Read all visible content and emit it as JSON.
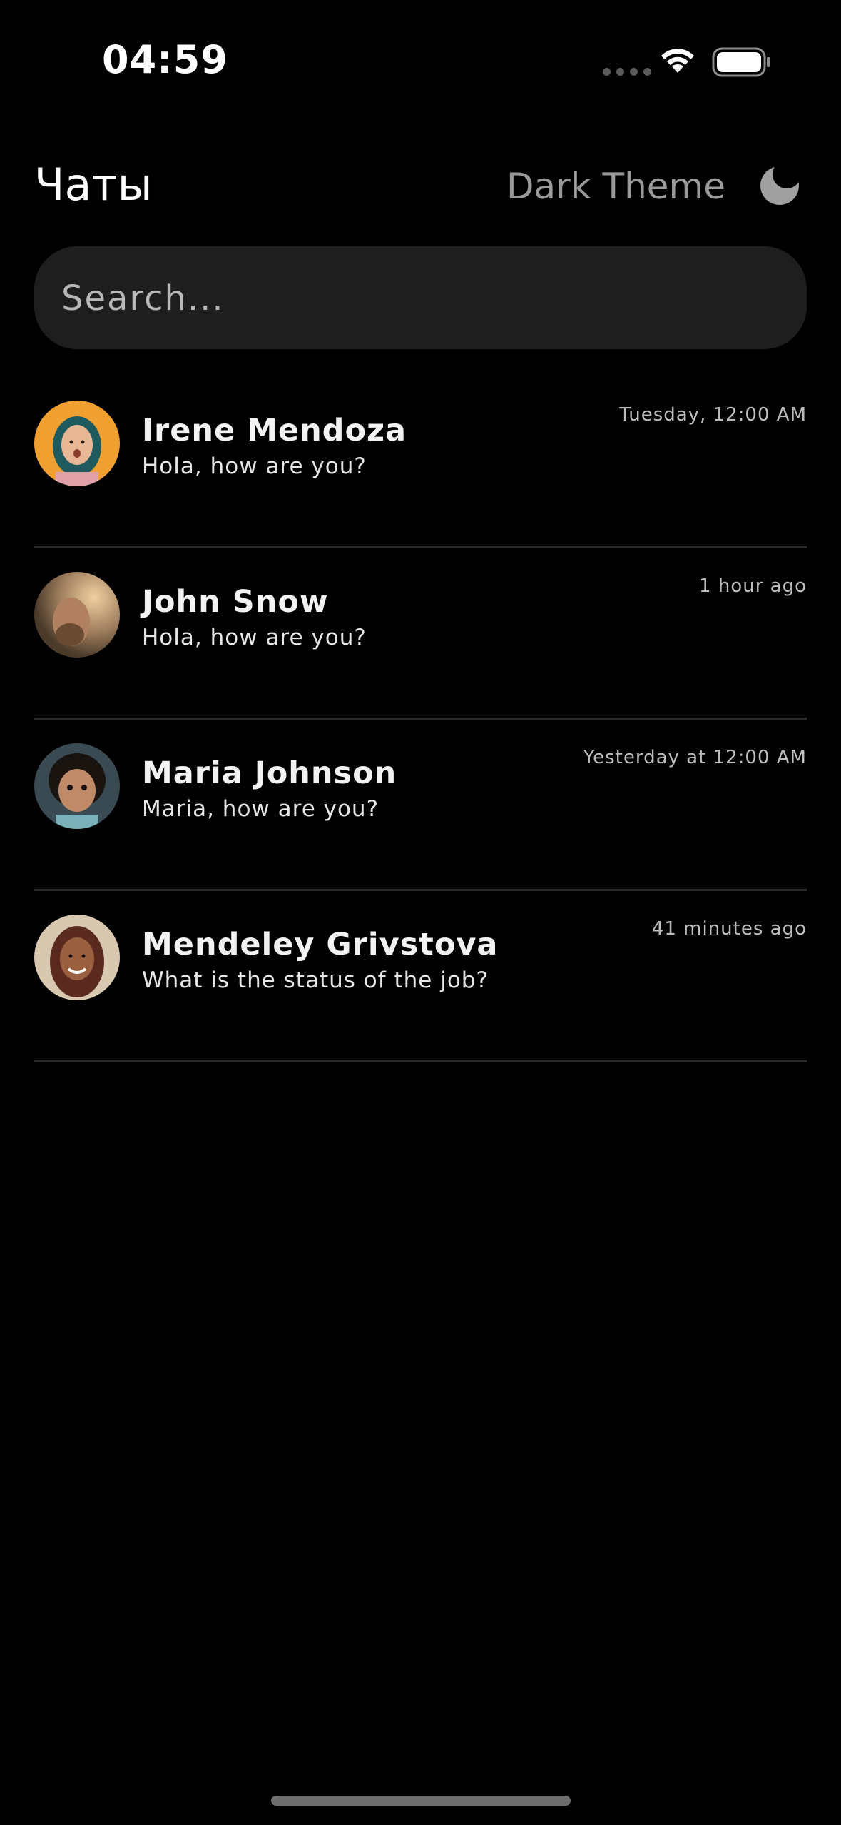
{
  "status_bar": {
    "time": "04:59"
  },
  "header": {
    "title": "Чаты",
    "theme_label": "Dark Theme",
    "theme_icon": "moon-icon"
  },
  "search": {
    "placeholder": "Search...",
    "value": ""
  },
  "chats": [
    {
      "name": "Irene Mendoza",
      "preview": "Hola, how are you?",
      "time": "Tuesday, 12:00 AM",
      "avatar_bg": "#f0a030"
    },
    {
      "name": "John Snow",
      "preview": "Hola, how are you?",
      "time": "1 hour ago",
      "avatar_bg": "#8a6a50"
    },
    {
      "name": "Maria Johnson",
      "preview": "Maria, how are you?",
      "time": "Yesterday at 12:00 AM",
      "avatar_bg": "#2a3a44"
    },
    {
      "name": "Mendeley Grivstova",
      "preview": "What is the status of the job?",
      "time": "41 minutes ago",
      "avatar_bg": "#c8b49a"
    }
  ],
  "colors": {
    "background": "#000000",
    "search_bg": "#1e1e1e",
    "muted_text": "#9a9a9a",
    "divider": "#2a2a2a"
  }
}
